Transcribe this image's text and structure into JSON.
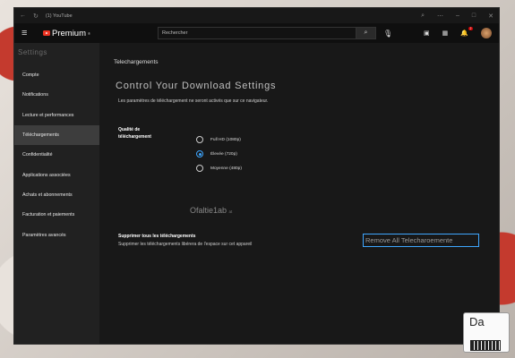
{
  "titlebar": {
    "app_title": "(1) YouTube"
  },
  "header": {
    "brand": "Premium",
    "search_placeholder": "Rechercher"
  },
  "notifications": {
    "count": "2"
  },
  "sidebar": {
    "heading": "Settings",
    "items": [
      {
        "label": "Compte"
      },
      {
        "label": "Notifications"
      },
      {
        "label": "Lecture et performances"
      },
      {
        "label": "Téléchargements"
      },
      {
        "label": "Confidentialité"
      },
      {
        "label": "Applications associées"
      },
      {
        "label": "Achats et abonnements"
      },
      {
        "label": "Facturation et paiements"
      },
      {
        "label": "Paramètres avancés"
      }
    ],
    "active_index": 3
  },
  "main": {
    "breadcrumb": "Telechargements",
    "title": "Control Your Download Settings",
    "description": "Les paramètres de téléchargement ne seront activés que sur ce navigateur.",
    "quality": {
      "label": "Qualité de téléchargement",
      "options": [
        {
          "label": "Full HD (1080p)",
          "selected": false
        },
        {
          "label": "Élevée (720p)",
          "selected": true
        },
        {
          "label": "Moyenne (480p)",
          "selected": false
        }
      ]
    },
    "offline_text": "Ofaltie1ab",
    "offline_suffix": "at",
    "delete": {
      "title": "Supprimer tous les téléchargements",
      "description": "Supprimer les téléchargements libérera de l'espace sur cet appareil",
      "button": "Remove All Telecharoemente"
    }
  },
  "watermark": {
    "text": "Da"
  },
  "colors": {
    "accent": "#3ea6ff",
    "brand": "#ee2222",
    "window": "#181818",
    "sidebar": "#212121"
  }
}
